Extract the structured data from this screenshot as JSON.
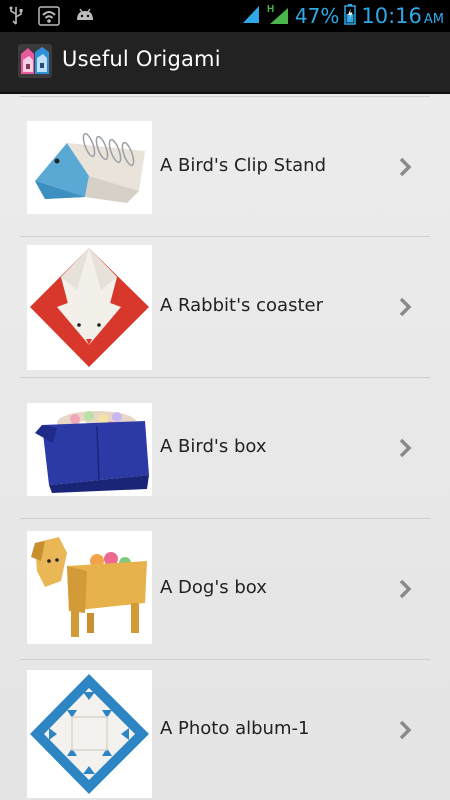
{
  "status_bar": {
    "network_type": "H",
    "battery_percent": "47%",
    "time": "10:16",
    "ampm": "AM",
    "icons": [
      "usb-icon",
      "wifi-icon",
      "android-icon",
      "signal-icon",
      "signal-h-icon",
      "battery-icon"
    ]
  },
  "app_bar": {
    "title": "Useful Origami",
    "icon": "origami-app-icon"
  },
  "list": {
    "items": [
      {
        "label": "A Bird's Clip Stand",
        "thumb": "bird-clip-stand-image"
      },
      {
        "label": "A Rabbit's coaster",
        "thumb": "rabbit-coaster-image"
      },
      {
        "label": "A Bird's box",
        "thumb": "bird-box-image"
      },
      {
        "label": "A Dog's box",
        "thumb": "dog-box-image"
      },
      {
        "label": "A Photo album-1",
        "thumb": "photo-album-image"
      }
    ]
  },
  "colors": {
    "status_accent": "#2ea9e6",
    "action_bar": "#222222",
    "list_bg": "#e9e9e9",
    "chevron": "#8a8a8a"
  }
}
